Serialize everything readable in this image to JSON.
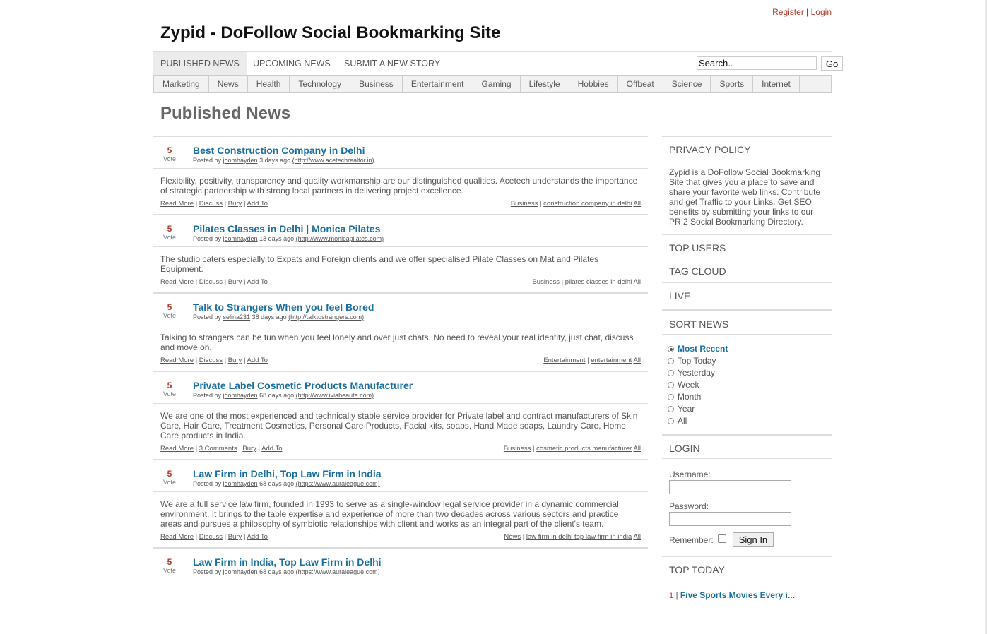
{
  "auth": {
    "register": "Register",
    "sep": "|",
    "login": "Login"
  },
  "site": {
    "title": "Zypid - DoFollow Social Bookmarking Site"
  },
  "nav": {
    "tabs": [
      "PUBLISHED NEWS",
      "UPCOMING NEWS",
      "SUBMIT A NEW STORY"
    ],
    "active_tab": "PUBLISHED NEWS",
    "search_value": "Search..",
    "go_label": "Go"
  },
  "categories": [
    "Marketing",
    "News",
    "Health",
    "Technology",
    "Business",
    "Entertainment",
    "Gaming",
    "Lifestyle",
    "Hobbies",
    "Offbeat",
    "Science",
    "Sports",
    "Internet"
  ],
  "page_title": "Published News",
  "stories": [
    {
      "votes": "5",
      "vote_label": "Vote",
      "title": "Best Construction Company in Delhi",
      "posted_by": "Posted by",
      "user": "joomhayden",
      "age": "3 days ago",
      "url": "(http://www.acetechrealtor.in)",
      "body": "Flexibility, positivity, transparency and quality workmanship are our distinguished qualities. Acetech understands the importance of strategic partnership with strong local partners in delivering project excellence.",
      "read_more": "Read More",
      "discuss": "Discuss",
      "bury": "Bury",
      "add_to": "Add To",
      "category": "Business",
      "tags": "construction company in delhi",
      "all": "All"
    },
    {
      "votes": "5",
      "vote_label": "Vote",
      "title": "Pilates Classes in Delhi | Monica Pilates",
      "posted_by": "Posted by",
      "user": "joomhayden",
      "age": "18 days ago",
      "url": "(http://www.monicapilates.com)",
      "body": "The studio caters especially to Expats and Foreign clients and we offer specialised Pilate Classes on Mat and Pilates Equipment.",
      "read_more": "Read More",
      "discuss": "Discuss",
      "bury": "Bury",
      "add_to": "Add To",
      "category": "Business",
      "tags": "pilates classes in delhi",
      "all": "All"
    },
    {
      "votes": "5",
      "vote_label": "Vote",
      "title": "Talk to Strangers When you feel Bored",
      "posted_by": "Posted by",
      "user": "selina231",
      "age": "38 days ago",
      "url": "(http://talktostrangers.com)",
      "body": "Talking to strangers can be fun when you feel lonely and over just chats. No need to reveal your real identity, just chat, discuss and move on.",
      "read_more": "Read More",
      "discuss": "Discuss",
      "bury": "Bury",
      "add_to": "Add To",
      "category": "Entertainment",
      "tags": "entertainment",
      "all": "All"
    },
    {
      "votes": "5",
      "vote_label": "Vote",
      "title": "Private Label Cosmetic Products Manufacturer",
      "posted_by": "Posted by",
      "user": "joomhayden",
      "age": "68 days ago",
      "url": "(http://www.iviabeaute.com)",
      "body": "We are one of the most experienced and technically stable service provider for Private label and contract manufacturers of Skin Care, Hair Care, Treatment Cosmetics, Personal Care Products, Facial kits, soaps, Hand Made soaps, Laundry Care, Home Care products in India.",
      "read_more": "Read More",
      "discuss": "3 Comments",
      "bury": "Bury",
      "add_to": "Add To",
      "category": "Business",
      "tags": "cosmetic products manufacturer",
      "all": "All"
    },
    {
      "votes": "5",
      "vote_label": "Vote",
      "title": "Law Firm in Delhi, Top Law Firm in India",
      "posted_by": "Posted by",
      "user": "joomhayden",
      "age": "68 days ago",
      "url": "(https://www.auraleague.com)",
      "body": "We are a full service law firm, founded in 1993 to serve as a single-window legal service provider in a dynamic commercial environment. It brings to the table expertise and experience of more than two decades across various sectors and practice areas and pursues a philosophy of symbiotic relationships with client and works as an integral part of the client's team.",
      "read_more": "Read More",
      "discuss": "Discuss",
      "bury": "Bury",
      "add_to": "Add To",
      "category": "News",
      "tags": "law firm in delhi top law firm in india",
      "all": "All"
    },
    {
      "votes": "5",
      "vote_label": "Vote",
      "title": "Law Firm in India, Top Law Firm in Delhi",
      "posted_by": "Posted by",
      "user": "joomhayden",
      "age": "68 days ago",
      "url": "(https://www.auraleague.com)",
      "body": "",
      "read_more": "",
      "discuss": "",
      "bury": "",
      "add_to": "",
      "category": "",
      "tags": "",
      "all": ""
    }
  ],
  "sidebar": {
    "privacy_title": "PRIVACY POLICY",
    "privacy_text": "Zypid is a DoFollow Social Bookmarking Site that gives you a place to save and share your favorite web links. Contribute and get Traffic to your Links. Get SEO benefits by submitting your links to our PR 2 Social Bookmarking Directory.",
    "top_users": "TOP USERS",
    "tag_cloud": "TAG CLOUD",
    "live": "LIVE",
    "sort_title": "SORT NEWS",
    "sort_options": [
      "Most Recent",
      "Top Today",
      "Yesterday",
      "Week",
      "Month",
      "Year",
      "All"
    ],
    "sort_selected": "Most Recent",
    "login_title": "LOGIN",
    "username_label": "Username:",
    "password_label": "Password:",
    "remember_label": "Remember:",
    "signin_label": "Sign In",
    "top_today_title": "TOP TODAY",
    "top_today_items": [
      {
        "rank": "1",
        "title": "Five Sports Movies Every i..."
      }
    ]
  },
  "colors": {
    "accent_link": "#1a6fa0",
    "vote_red": "#b03a2e",
    "text_gray": "#555555"
  }
}
